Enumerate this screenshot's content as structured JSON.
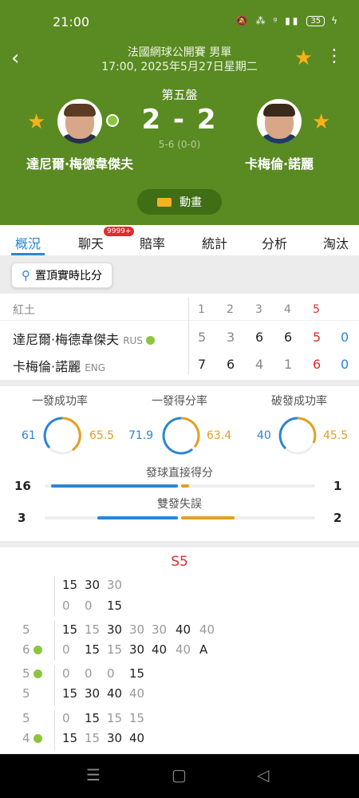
{
  "status_bar": {
    "time": "21:00",
    "icons": "🔕 ⁂ ᵍ ▮▮",
    "battery": "35",
    "charging": "ϟ"
  },
  "header": {
    "title": "法國網球公開賽 男單",
    "subtitle": "17:00, 2025年5月27日星期二",
    "set_label": "第五盤",
    "score": "2 - 2",
    "game_score": "5-6 (0-0)",
    "player1": "達尼爾·梅德韋傑夫",
    "player2": "卡梅倫·諾麗",
    "animation_label": "動畫"
  },
  "icons": {
    "back": "‹",
    "star": "★",
    "more": "⋮",
    "pin": "⚲",
    "nav_menu": "☰",
    "nav_home": "▢",
    "nav_back": "◁"
  },
  "colors": {
    "header_green": "#5a8a22",
    "accent_blue": "#2a86d4",
    "accent_orange": "#e0a020",
    "red": "#e02b2b"
  },
  "tabs": [
    {
      "label": "概況"
    },
    {
      "label": "聊天"
    },
    {
      "label": "賠率"
    },
    {
      "label": "統計"
    },
    {
      "label": "分析"
    },
    {
      "label": "淘汰賽"
    }
  ],
  "chat_badge": "9999+",
  "pin_button": "置頂實時比分",
  "scoreboard": {
    "surface": "紅土",
    "set_headers": [
      "1",
      "2",
      "3",
      "4",
      "5"
    ],
    "players": [
      {
        "name": "達尼爾·梅德韋傑夫",
        "country": "RUS",
        "sets": [
          "5",
          "3",
          "6",
          "6",
          "5"
        ],
        "points": "0"
      },
      {
        "name": "卡梅倫·諾麗",
        "country": "ENG",
        "sets": [
          "7",
          "6",
          "4",
          "1",
          "6"
        ],
        "points": "0"
      }
    ]
  },
  "stats": {
    "rings": [
      {
        "title": "一發成功率",
        "left": "61",
        "right": "65.5"
      },
      {
        "title": "一發得分率",
        "left": "71.9",
        "right": "63.4"
      },
      {
        "title": "破發成功率",
        "left": "40",
        "right": "45.5"
      }
    ],
    "bars": [
      {
        "title": "發球直接得分",
        "left": "16",
        "right": "1"
      },
      {
        "title": "雙發失誤",
        "left": "3",
        "right": "2"
      }
    ]
  },
  "pbp": {
    "title": "S5",
    "games": [
      {
        "top_score": "",
        "bottom_score": "",
        "top_points": [
          "15",
          "30",
          "30"
        ],
        "bottom_points": [
          "0",
          "0",
          "15"
        ]
      },
      {
        "top_score": "5",
        "bottom_score": "6",
        "top_points": [
          "15",
          "15",
          "30",
          "30",
          "30",
          "40",
          "40"
        ],
        "bottom_points": [
          "0",
          "15",
          "15",
          "30",
          "40",
          "40",
          "A"
        ]
      },
      {
        "top_score": "5",
        "bottom_score": "5",
        "top_points": [
          "0",
          "0",
          "0",
          "15"
        ],
        "bottom_points": [
          "15",
          "30",
          "40",
          "40"
        ]
      },
      {
        "top_score": "5",
        "bottom_score": "4",
        "top_points": [
          "0",
          "15",
          "15",
          "15"
        ],
        "bottom_points": [
          "15",
          "15",
          "30",
          "40"
        ]
      }
    ]
  }
}
